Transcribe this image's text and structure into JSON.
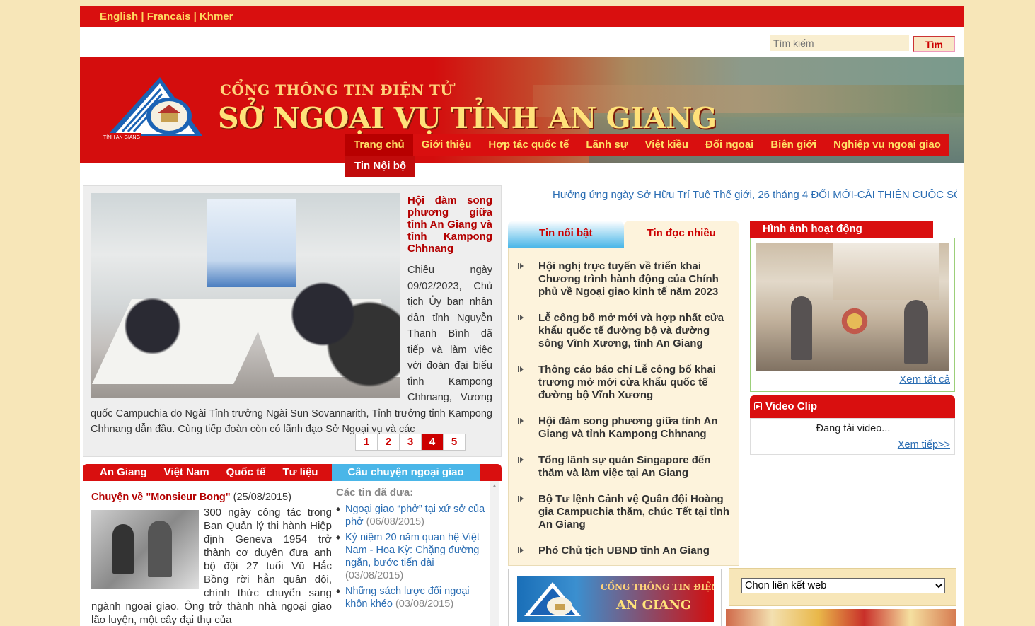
{
  "lang": {
    "english": "English",
    "francais": "Francais",
    "khmer": "Khmer",
    "sep": " | "
  },
  "search": {
    "placeholder": "Tìm kiếm",
    "button": "Tìm"
  },
  "banner": {
    "subtitle": "CỔNG THÔNG TIN ĐIỆN TỬ",
    "title": "SỞ NGOẠI VỤ TỈNH AN GIANG",
    "logo_text": "TỈNH AN GIANG"
  },
  "nav": {
    "items": [
      "Trang chủ",
      "Giới thiệu",
      "Hợp tác quốc tế",
      "Lãnh sự",
      "Việt kiều",
      "Đối ngoại",
      "Biên giới",
      "Nghiệp vụ ngoại giao"
    ],
    "sub": "Tin Nội bộ"
  },
  "feature": {
    "title": "Hội đàm song phương giữa tỉnh An Giang và tỉnh Kampong Chhnang",
    "body": "Chiều ngày 09/02/2023, Chủ tịch Ủy ban nhân dân tỉnh Nguyễn Thanh Bình đã tiếp và làm việc với đoàn đại biểu tỉnh Kampong Chhnang, Vương quốc Campuchia do Ngài Tỉnh trưởng Ngài Sun Sovannarith, Tỉnh trưởng tỉnh Kampong Chhnang dẫn đầu. Cùng tiếp đoàn còn có lãnh đạo Sở Ngoại vụ và các",
    "pages": [
      "1",
      "2",
      "3",
      "4",
      "5"
    ],
    "current_page": "4"
  },
  "marquee": "Hưởng ứng ngày Sở Hữu Trí Tuệ Thế giới, 26 tháng 4 ĐỔI MỚI-CẢI THIỆN CUỘC SỐ",
  "category_tabs": [
    "An Giang",
    "Việt Nam",
    "Quốc tế",
    "Tư liệu",
    "Câu chuyện ngoại giao"
  ],
  "story": {
    "title": "Chuyện về \"Monsieur Bong\"",
    "date": "(25/08/2015)",
    "body": "300 ngày công tác trong Ban Quản lý thi hành Hiệp định Geneva 1954 trở thành cơ duyên đưa anh bộ đội 27 tuổi Vũ Hắc Bồng rời hẳn quân đội, chính thức chuyển sang ngành ngoại giao. Ông trở thành nhà ngoại giao lão luyện, một cây đại thụ của"
  },
  "older": {
    "heading": "Các tin đã đưa:",
    "items": [
      {
        "title": "Ngoại giao “phở” tại xứ sở của phở",
        "date": "(06/08/2015)"
      },
      {
        "title": "Kỷ niệm 20 năm quan hệ Việt Nam - Hoa Kỳ: Chặng đường ngắn, bước tiến dài",
        "date": "(03/08/2015)"
      },
      {
        "title": "Những sách lược đối ngoại khôn khéo",
        "date": "(03/08/2015)"
      }
    ]
  },
  "news_tabs": {
    "featured": "Tin nổi bật",
    "most_read": "Tin đọc nhiều"
  },
  "news": [
    "Hội nghị trực tuyến về triển khai Chương trình hành động của Chính phủ về Ngoại giao kinh tế năm 2023",
    "Lễ công bố mở mới và hợp nhất cửa khẩu quốc tế đường bộ và đường sông Vĩnh Xương, tỉnh An Giang",
    "Thông cáo báo chí Lễ công bố khai trương mở mới cửa khẩu quốc tế đường bộ Vĩnh Xương",
    "Hội đàm song phương giữa tỉnh An Giang và tỉnh Kampong Chhnang",
    "Tổng lãnh sự quán Singapore đến thăm và làm việc tại An Giang",
    "Bộ Tư lệnh Cảnh vệ Quân đội Hoàng gia Campuchia thăm, chúc Tết tại tỉnh An Giang",
    "Phó Chủ tịch UBND tỉnh An Giang"
  ],
  "activity": {
    "heading": "Hình ảnh hoạt động",
    "see_all": "Xem tất cả"
  },
  "video": {
    "heading": "Video Clip",
    "loading": "Đang tải video...",
    "more": "Xem tiếp>>"
  },
  "weblinks": {
    "selected": "Chọn liên kết web"
  },
  "bottom_banner": {
    "line1": "CỔNG THÔNG TIN ĐIỆN TỬ",
    "line2": "AN GIANG"
  },
  "colors": {
    "brand_red": "#d90f0f",
    "accent_blue": "#4ab6e8",
    "link": "#2a6db3",
    "page_bg": "#f7e6b8"
  }
}
